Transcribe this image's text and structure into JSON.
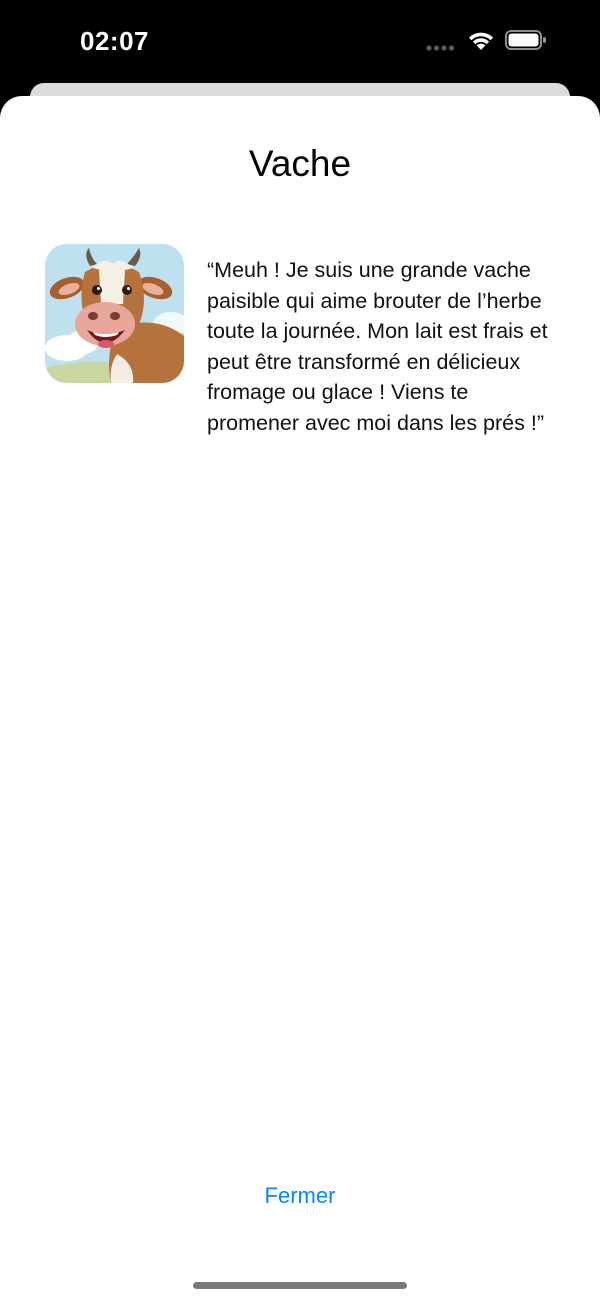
{
  "status_bar": {
    "time": "02:07"
  },
  "sheet": {
    "title": "Vache",
    "avatar_icon": "cow-illustration",
    "quote": "“Meuh ! Je suis une grande vache paisible qui aime brouter de l’herbe toute la journée. Mon lait est frais et peut être transformé en délicieux fromage ou glace ! Viens te promener avec moi dans les prés !”",
    "close_label": "Fermer"
  },
  "colors": {
    "accent": "#0a84ff",
    "background": "#ffffff",
    "status_bar": "#000000"
  }
}
